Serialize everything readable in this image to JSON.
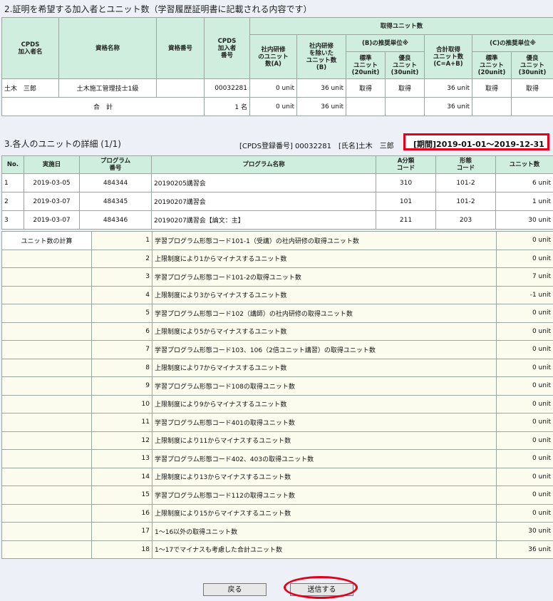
{
  "section2": {
    "title": "2.証明を希望する加入者とユニット数（学習履歴証明書に記載される内容です）",
    "headers": {
      "name": "CPDS\n加入者名",
      "qual_name": "資格名称",
      "qual_no": "資格番号",
      "cpds_no": "CPDS\n加入者\n番号",
      "acquired": "取得ユニット数",
      "in_house": "社内研修\nのユニット\n数(A)",
      "excluding": "社内研修\nを除いた\nユニット数\n(B)",
      "b_rec": "(B)の推奨単位※",
      "std": "標準\nユニット\n(20unit)",
      "exc": "優良\nユニット\n(30unit)",
      "total": "合計取得\nユニット数\n(C=A+B)",
      "c_rec": "(C)の推奨単位※"
    },
    "row": {
      "name": "土木　三郎",
      "qual_name": "土木施工管理技士1級",
      "qual_no": "",
      "cpds_no": "00032281",
      "in_house": "0 unit",
      "excluding": "36 unit",
      "b_std": "取得",
      "b_exc": "取得",
      "total": "36 unit",
      "c_std": "取得",
      "c_exc": "取得"
    },
    "total_row": {
      "label": "合　計",
      "count": "1 名",
      "in_house": "0 unit",
      "excluding": "36 unit",
      "total": "36 unit"
    }
  },
  "section3": {
    "title": "3.各人のユニットの詳細 (1/1)",
    "info": "[CPDS登録番号] 00032281　[氏名]土木　三郎",
    "period": "[期間]2019-01-01～2019-12-31",
    "headers": [
      "No.",
      "実施日",
      "プログラム\n番号",
      "プログラム名称",
      "A分類\nコード",
      "形態\nコード",
      "ユニット数"
    ],
    "rows": [
      {
        "no": "1",
        "date": "2019-03-05",
        "prog": "484344",
        "name": "20190205講習会",
        "a": "310",
        "form": "101-2",
        "units": "6 unit"
      },
      {
        "no": "2",
        "date": "2019-03-07",
        "prog": "484345",
        "name": "20190207講習会",
        "a": "101",
        "form": "101-2",
        "units": "1 unit"
      },
      {
        "no": "3",
        "date": "2019-03-07",
        "prog": "484346",
        "name": "20190207講習会【論文：主】",
        "a": "211",
        "form": "203",
        "units": "30 unit"
      }
    ],
    "calc_label": "ユニット数の計算",
    "calc": [
      {
        "n": "1",
        "text": "学習プログラム形態コード101-1（受講）の社内研修の取得ユニット数",
        "v": "0 unit"
      },
      {
        "n": "2",
        "text": "上限制度により1からマイナスするユニット数",
        "v": "0 unit"
      },
      {
        "n": "3",
        "text": "学習プログラム形態コード101-2の取得ユニット数",
        "v": "7 unit"
      },
      {
        "n": "4",
        "text": "上限制度により3からマイナスするユニット数",
        "v": "-1 unit"
      },
      {
        "n": "5",
        "text": "学習プログラム形態コード102（講師）の社内研修の取得ユニット数",
        "v": "0 unit"
      },
      {
        "n": "6",
        "text": "上限制度により5からマイナスするユニット数",
        "v": "0 unit"
      },
      {
        "n": "7",
        "text": "学習プログラム形態コード103、106（2倍ユニット講習）の取得ユニット数",
        "v": "0 unit"
      },
      {
        "n": "8",
        "text": "上限制度により7からマイナスするユニット数",
        "v": "0 unit"
      },
      {
        "n": "9",
        "text": "学習プログラム形態コード108の取得ユニット数",
        "v": "0 unit"
      },
      {
        "n": "10",
        "text": "上限制度により9からマイナスするユニット数",
        "v": "0 unit"
      },
      {
        "n": "11",
        "text": "学習プログラム形態コード401の取得ユニット数",
        "v": "0 unit"
      },
      {
        "n": "12",
        "text": "上限制度により11からマイナスするユニット数",
        "v": "0 unit"
      },
      {
        "n": "13",
        "text": "学習プログラム形態コード402、403の取得ユニット数",
        "v": "0 unit"
      },
      {
        "n": "14",
        "text": "上限制度により13からマイナスするユニット数",
        "v": "0 unit"
      },
      {
        "n": "15",
        "text": "学習プログラム形態コード112の取得ユニット数",
        "v": "0 unit"
      },
      {
        "n": "16",
        "text": "上限制度により15からマイナスするユニット数",
        "v": "0 unit"
      },
      {
        "n": "17",
        "text": "1～16以外の取得ユニット数",
        "v": "30 unit"
      },
      {
        "n": "18",
        "text": "1～17でマイナスも考慮した合計ユニット数",
        "v": "36 unit"
      }
    ]
  },
  "buttons": {
    "back": "戻る",
    "send": "送信する"
  }
}
